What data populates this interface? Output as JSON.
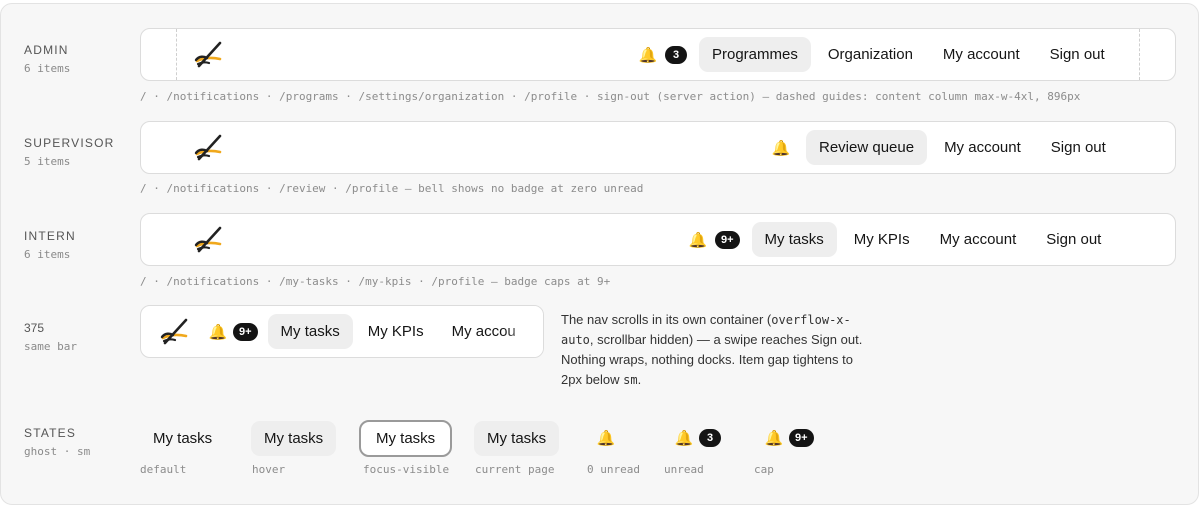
{
  "rows": {
    "admin": {
      "label": "ADMIN",
      "count": "6 items",
      "badge": "3",
      "items": [
        "Programmes",
        "Organization",
        "My account",
        "Sign out"
      ],
      "caption": "/ · /notifications · /programs · /settings/organization · /profile · sign-out (server action) — dashed guides: content column max-w-4xl, 896px"
    },
    "supervisor": {
      "label": "SUPERVISOR",
      "count": "5 items",
      "items": [
        "Review queue",
        "My account",
        "Sign out"
      ],
      "caption": "/ · /notifications · /review · /profile — bell shows no badge at zero unread"
    },
    "intern": {
      "label": "INTERN",
      "count": "6 items",
      "badge": "9+",
      "items": [
        "My tasks",
        "My KPIs",
        "My account",
        "Sign out"
      ],
      "caption": "/ · /notifications · /my-tasks · /my-kpis · /profile — badge caps at 9+"
    },
    "mobile": {
      "label": "375",
      "count": "same bar",
      "badge": "9+",
      "items": [
        "My tasks",
        "My KPIs",
        "My accou"
      ],
      "note_parts": [
        "The nav scrolls in its own container (",
        "overflow-x-auto",
        ", scrollbar hidden) — a swipe reaches Sign out. Nothing wraps, nothing docks. Item gap tightens to 2px below ",
        "sm",
        "."
      ]
    },
    "states": {
      "label": "STATES",
      "count": "ghost · sm",
      "item_label": "My tasks",
      "badge_unread": "3",
      "badge_cap": "9+",
      "labels": [
        "default",
        "hover",
        "focus-visible",
        "current page",
        "0 unread",
        "unread",
        "cap"
      ]
    }
  },
  "colors": {
    "bell": "#e0a400",
    "badge": "#141414",
    "active_bg": "#eeeeee",
    "focus_ring": "#9a9a9a"
  },
  "icons": {
    "logo": "scissors-logo-icon",
    "bell": "bell-icon"
  }
}
